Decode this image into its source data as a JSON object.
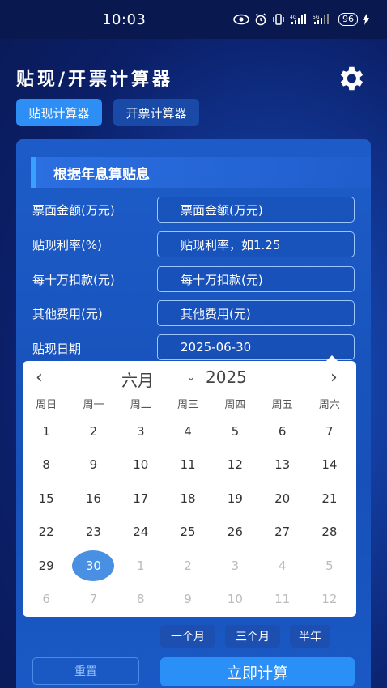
{
  "status": {
    "time": "10:03",
    "battery": "96"
  },
  "header": {
    "title": "贴现/开票计算器",
    "settings_icon": "gear-icon"
  },
  "tabs": [
    {
      "label": "贴现计算器",
      "active": true
    },
    {
      "label": "开票计算器",
      "active": false
    }
  ],
  "section": {
    "title": "根据年息算贴息"
  },
  "form": {
    "fields": [
      {
        "label": "票面金额(万元)",
        "placeholder": "票面金额(万元)"
      },
      {
        "label": "贴现利率(%)",
        "placeholder": "贴现利率，如1.25"
      },
      {
        "label": "每十万扣款(元)",
        "placeholder": "每十万扣款(元)"
      },
      {
        "label": "其他费用(元)",
        "placeholder": "其他费用(元)"
      },
      {
        "label": "贴现日期",
        "value": "2025-06-30"
      }
    ]
  },
  "calendar": {
    "month": "六月",
    "year": "2025",
    "weekdays": [
      "周日",
      "周一",
      "周二",
      "周三",
      "周四",
      "周五",
      "周六"
    ],
    "weeks": [
      [
        "1",
        "2",
        "3",
        "4",
        "5",
        "6",
        "7"
      ],
      [
        "8",
        "9",
        "10",
        "11",
        "12",
        "13",
        "14"
      ],
      [
        "15",
        "16",
        "17",
        "18",
        "19",
        "20",
        "21"
      ],
      [
        "22",
        "23",
        "24",
        "25",
        "26",
        "27",
        "28"
      ],
      [
        "29",
        "30",
        "1",
        "2",
        "3",
        "4",
        "5"
      ],
      [
        "6",
        "7",
        "8",
        "9",
        "10",
        "11",
        "12"
      ]
    ],
    "selected": "30"
  },
  "quick_buttons": [
    "一个月",
    "三个月",
    "半年"
  ],
  "actions": {
    "reset": "重置",
    "calculate": "立即计算"
  },
  "colors": {
    "accent": "#2a8ff7",
    "selected_day": "#4a90e2"
  }
}
